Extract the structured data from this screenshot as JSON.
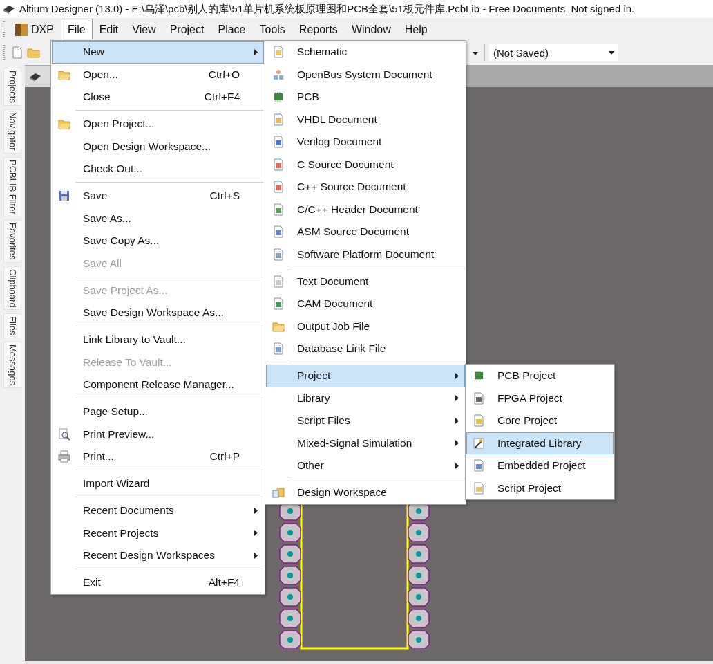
{
  "window": {
    "title": "Altium Designer (13.0) - E:\\乌泽\\pcb\\别人的库\\51单片机系统板原理图和PCB全套\\51板元件库.PcbLib - Free Documents. Not signed in."
  },
  "menubar": [
    {
      "label": "DXP",
      "selected": false
    },
    {
      "label": "File",
      "selected": true
    },
    {
      "label": "Edit",
      "selected": false
    },
    {
      "label": "View",
      "selected": false
    },
    {
      "label": "Project",
      "selected": false
    },
    {
      "label": "Place",
      "selected": false
    },
    {
      "label": "Tools",
      "selected": false
    },
    {
      "label": "Reports",
      "selected": false
    },
    {
      "label": "Window",
      "selected": false
    },
    {
      "label": "Help",
      "selected": false
    }
  ],
  "toolbar": {
    "combo": {
      "value": "(Not Saved)"
    }
  },
  "sidebar": {
    "tabs": [
      {
        "label": "Projects"
      },
      {
        "label": "Navigator"
      },
      {
        "label": "PCBLIB Filter"
      },
      {
        "label": "Favorites"
      },
      {
        "label": "Clipboard"
      },
      {
        "label": "Files"
      },
      {
        "label": "Messages"
      }
    ]
  },
  "file_menu": {
    "items": [
      {
        "kind": "item",
        "label": "New",
        "submenu": true,
        "selected": true,
        "disabled": false
      },
      {
        "kind": "item",
        "label": "Open...",
        "shortcut": "Ctrl+O",
        "selected": false,
        "disabled": false
      },
      {
        "kind": "item",
        "label": "Close",
        "shortcut": "Ctrl+F4",
        "selected": false,
        "disabled": false
      },
      {
        "kind": "separator"
      },
      {
        "kind": "item",
        "label": "Open Project...",
        "selected": false,
        "disabled": false
      },
      {
        "kind": "item",
        "label": "Open Design Workspace...",
        "selected": false,
        "disabled": false
      },
      {
        "kind": "item",
        "label": "Check Out...",
        "selected": false,
        "disabled": false
      },
      {
        "kind": "separator"
      },
      {
        "kind": "item",
        "label": "Save",
        "shortcut": "Ctrl+S",
        "selected": false,
        "disabled": false
      },
      {
        "kind": "item",
        "label": "Save As...",
        "selected": false,
        "disabled": false
      },
      {
        "kind": "item",
        "label": "Save Copy As...",
        "selected": false,
        "disabled": false
      },
      {
        "kind": "item",
        "label": "Save All",
        "selected": false,
        "disabled": true
      },
      {
        "kind": "separator"
      },
      {
        "kind": "item",
        "label": "Save Project As...",
        "selected": false,
        "disabled": true
      },
      {
        "kind": "item",
        "label": "Save Design Workspace As...",
        "selected": false,
        "disabled": false
      },
      {
        "kind": "separator"
      },
      {
        "kind": "item",
        "label": "Link Library to Vault...",
        "selected": false,
        "disabled": false
      },
      {
        "kind": "item",
        "label": "Release To Vault...",
        "selected": false,
        "disabled": true
      },
      {
        "kind": "item",
        "label": "Component Release Manager...",
        "selected": false,
        "disabled": false
      },
      {
        "kind": "separator"
      },
      {
        "kind": "item",
        "label": "Page Setup...",
        "selected": false,
        "disabled": false
      },
      {
        "kind": "item",
        "label": "Print Preview...",
        "selected": false,
        "disabled": false
      },
      {
        "kind": "item",
        "label": "Print...",
        "shortcut": "Ctrl+P",
        "selected": false,
        "disabled": false
      },
      {
        "kind": "separator"
      },
      {
        "kind": "item",
        "label": "Import Wizard",
        "selected": false,
        "disabled": false
      },
      {
        "kind": "separator"
      },
      {
        "kind": "item",
        "label": "Recent Documents",
        "submenu": true,
        "selected": false,
        "disabled": false
      },
      {
        "kind": "item",
        "label": "Recent Projects",
        "submenu": true,
        "selected": false,
        "disabled": false
      },
      {
        "kind": "item",
        "label": "Recent Design Workspaces",
        "submenu": true,
        "selected": false,
        "disabled": false
      },
      {
        "kind": "separator"
      },
      {
        "kind": "item",
        "label": "Exit",
        "shortcut": "Alt+F4",
        "selected": false,
        "disabled": false
      }
    ]
  },
  "new_menu": {
    "items": [
      {
        "kind": "item",
        "label": "Schematic",
        "selected": false,
        "disabled": false
      },
      {
        "kind": "item",
        "label": "OpenBus System Document",
        "selected": false,
        "disabled": false
      },
      {
        "kind": "item",
        "label": "PCB",
        "selected": false,
        "disabled": false
      },
      {
        "kind": "item",
        "label": "VHDL Document",
        "selected": false,
        "disabled": false
      },
      {
        "kind": "item",
        "label": "Verilog Document",
        "selected": false,
        "disabled": false
      },
      {
        "kind": "item",
        "label": "C Source Document",
        "selected": false,
        "disabled": false
      },
      {
        "kind": "item",
        "label": "C++ Source Document",
        "selected": false,
        "disabled": false
      },
      {
        "kind": "item",
        "label": "C/C++ Header Document",
        "selected": false,
        "disabled": false
      },
      {
        "kind": "item",
        "label": "ASM Source Document",
        "selected": false,
        "disabled": false
      },
      {
        "kind": "item",
        "label": "Software Platform Document",
        "selected": false,
        "disabled": false
      },
      {
        "kind": "separator"
      },
      {
        "kind": "item",
        "label": "Text Document",
        "selected": false,
        "disabled": false
      },
      {
        "kind": "item",
        "label": "CAM Document",
        "selected": false,
        "disabled": false
      },
      {
        "kind": "item",
        "label": "Output Job File",
        "selected": false,
        "disabled": false
      },
      {
        "kind": "item",
        "label": "Database Link File",
        "selected": false,
        "disabled": false
      },
      {
        "kind": "separator"
      },
      {
        "kind": "item",
        "label": "Project",
        "submenu": true,
        "selected": true,
        "disabled": false
      },
      {
        "kind": "item",
        "label": "Library",
        "submenu": true,
        "selected": false,
        "disabled": false
      },
      {
        "kind": "item",
        "label": "Script Files",
        "submenu": true,
        "selected": false,
        "disabled": false
      },
      {
        "kind": "item",
        "label": "Mixed-Signal Simulation",
        "submenu": true,
        "selected": false,
        "disabled": false
      },
      {
        "kind": "item",
        "label": "Other",
        "submenu": true,
        "selected": false,
        "disabled": false
      },
      {
        "kind": "separator"
      },
      {
        "kind": "item",
        "label": "Design Workspace",
        "selected": false,
        "disabled": false
      }
    ]
  },
  "project_menu": {
    "items": [
      {
        "kind": "item",
        "label": "PCB Project",
        "selected": false,
        "disabled": false
      },
      {
        "kind": "item",
        "label": "FPGA Project",
        "selected": false,
        "disabled": false
      },
      {
        "kind": "item",
        "label": "Core Project",
        "selected": false,
        "disabled": false
      },
      {
        "kind": "item",
        "label": "Integrated Library",
        "selected": true,
        "disabled": false
      },
      {
        "kind": "item",
        "label": "Embedded Project",
        "selected": false,
        "disabled": false
      },
      {
        "kind": "item",
        "label": "Script Project",
        "selected": false,
        "disabled": false
      }
    ]
  }
}
